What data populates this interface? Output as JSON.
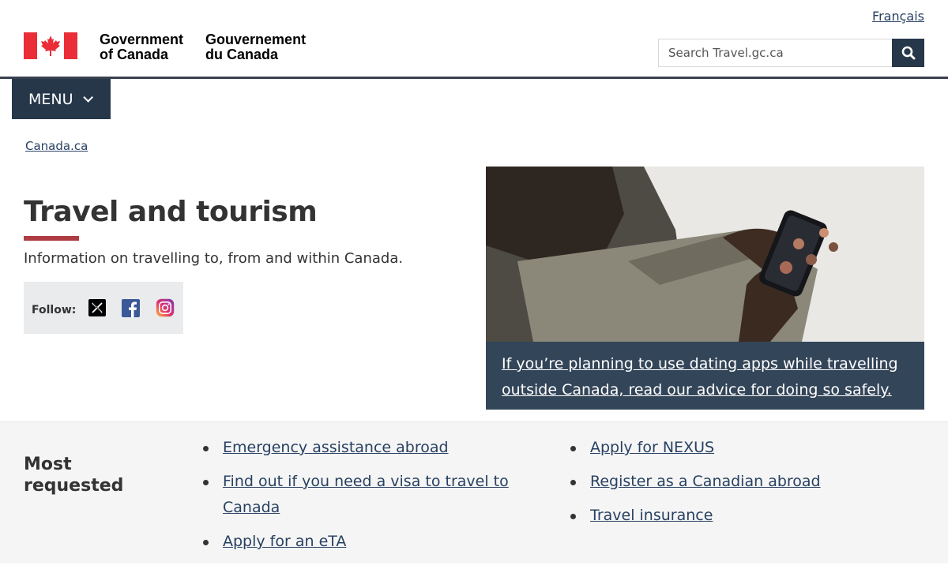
{
  "header": {
    "language_toggle": "Français",
    "brand_en_line1": "Government",
    "brand_en_line2": "of Canada",
    "brand_fr_line1": "Gouvernement",
    "brand_fr_line2": "du Canada",
    "search_placeholder": "Search Travel.gc.ca",
    "search_icon": "magnifier-icon",
    "flag_color": "#ea2d37",
    "nav_color": "#26374a"
  },
  "menu": {
    "label": "MENU"
  },
  "breadcrumb": {
    "item": "Canada.ca"
  },
  "hero": {
    "title": "Travel and tourism",
    "intro": "Information on travelling to, from and within Canada.",
    "follow_label": "Follow:",
    "social": [
      "x-icon",
      "facebook-icon",
      "instagram-icon"
    ],
    "accent_color": "#af3c43"
  },
  "feature": {
    "caption": "If you’re planning to use dating apps while travelling outside Canada, read our advice for doing so safely."
  },
  "most_requested": {
    "heading_line1": "Most",
    "heading_line2": "requested",
    "col1": [
      "Emergency assistance abroad",
      "Find out if you need a visa to travel to Canada",
      "Apply for an eTA"
    ],
    "col2": [
      "Apply for NEXUS",
      "Register as a Canadian abroad",
      "Travel insurance"
    ]
  }
}
